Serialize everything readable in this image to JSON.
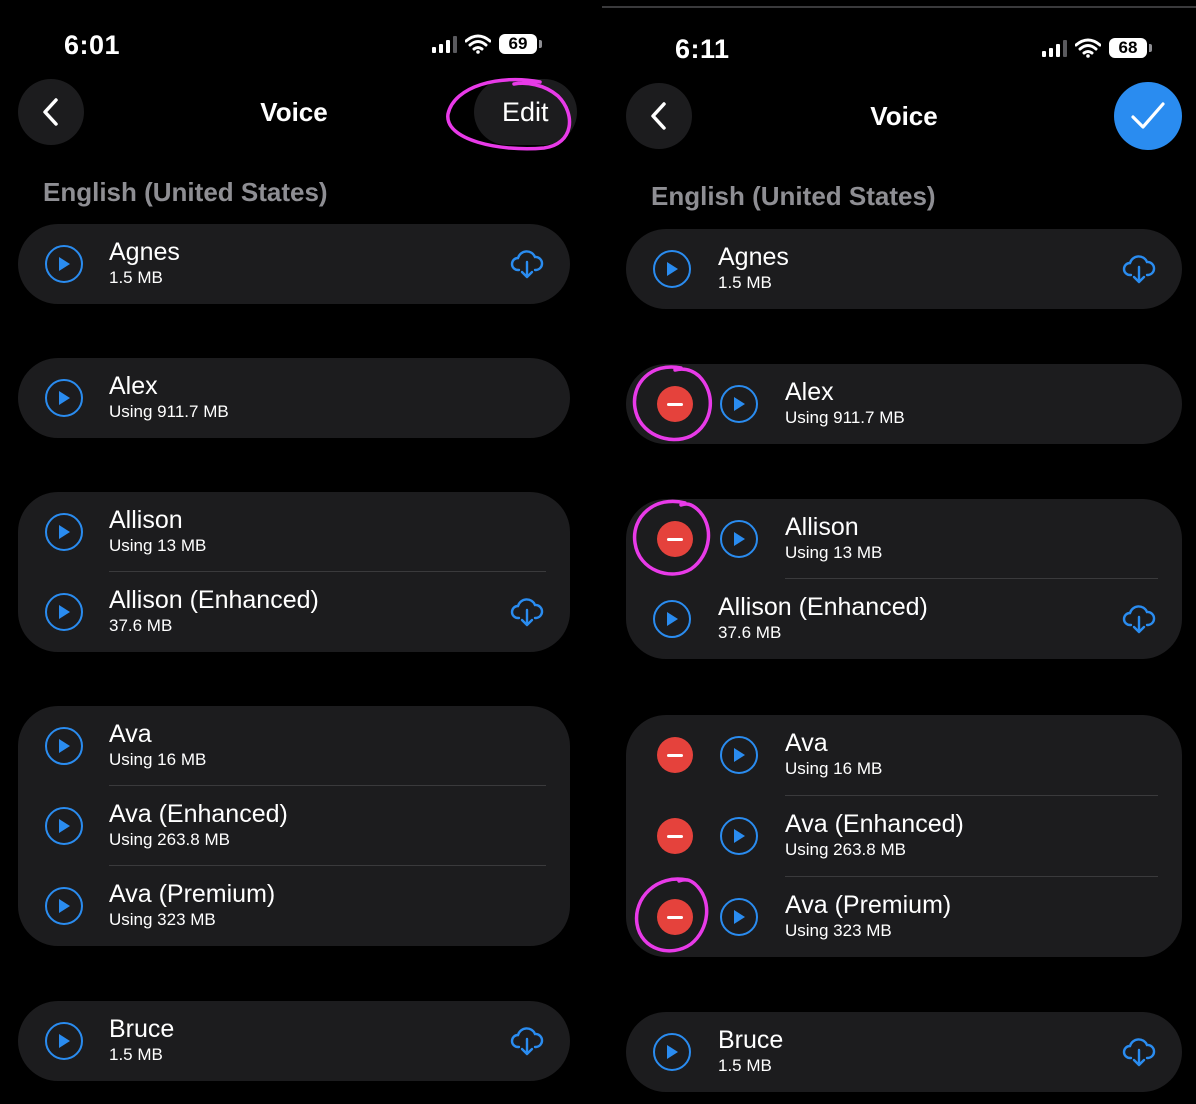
{
  "colors": {
    "accent": "#2a8cf0",
    "delete": "#e5423c",
    "annotation": "#e83ae8",
    "row_bg": "#1c1c1e"
  },
  "left": {
    "status": {
      "time": "6:01",
      "battery": "69"
    },
    "nav": {
      "back_icon": "chevron-left-icon",
      "title": "Voice",
      "edit_label": "Edit"
    },
    "section_header": "English (United States)",
    "groups": [
      {
        "rows": [
          {
            "name": "Agnes",
            "size": "1.5 MB",
            "download": true
          }
        ]
      },
      {
        "rows": [
          {
            "name": "Alex",
            "size": "Using 911.7 MB",
            "download": false
          }
        ]
      },
      {
        "rows": [
          {
            "name": "Allison",
            "size": "Using 13 MB",
            "download": false
          },
          {
            "name": "Allison (Enhanced)",
            "size": "37.6 MB",
            "download": true
          }
        ]
      },
      {
        "rows": [
          {
            "name": "Ava",
            "size": "Using 16 MB",
            "download": false
          },
          {
            "name": "Ava (Enhanced)",
            "size": "Using 263.8 MB",
            "download": false
          },
          {
            "name": "Ava (Premium)",
            "size": "Using 323 MB",
            "download": false
          }
        ]
      },
      {
        "rows": [
          {
            "name": "Bruce",
            "size": "1.5 MB",
            "download": true
          }
        ]
      }
    ]
  },
  "right": {
    "status": {
      "time": "6:11",
      "battery": "68"
    },
    "nav": {
      "back_icon": "chevron-left-icon",
      "title": "Voice",
      "done_icon": "checkmark-icon"
    },
    "section_header": "English (United States)",
    "groups": [
      {
        "rows": [
          {
            "name": "Agnes",
            "size": "1.5 MB",
            "download": true
          }
        ]
      },
      {
        "rows": [
          {
            "name": "Alex",
            "size": "Using 911.7 MB",
            "download": false
          }
        ]
      },
      {
        "rows": [
          {
            "name": "Allison",
            "size": "Using 13 MB",
            "download": false
          },
          {
            "name": "Allison (Enhanced)",
            "size": "37.6 MB",
            "download": true
          }
        ]
      },
      {
        "rows": [
          {
            "name": "Ava",
            "size": "Using 16 MB",
            "download": false
          },
          {
            "name": "Ava (Enhanced)",
            "size": "Using 263.8 MB",
            "download": false
          },
          {
            "name": "Ava (Premium)",
            "size": "Using 323 MB",
            "download": false
          }
        ]
      },
      {
        "rows": [
          {
            "name": "Bruce",
            "size": "1.5 MB",
            "download": true
          }
        ]
      }
    ]
  }
}
